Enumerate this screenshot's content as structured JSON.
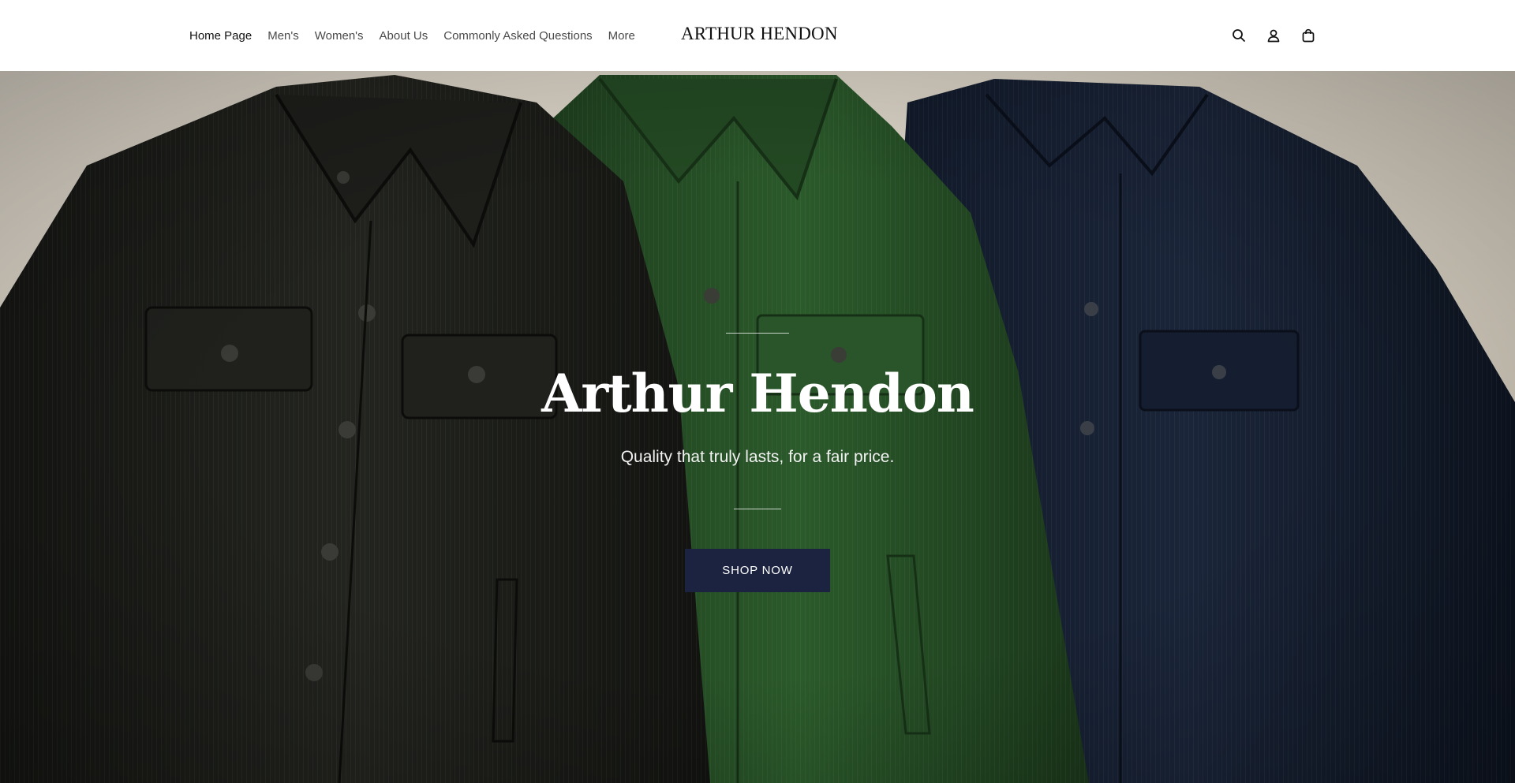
{
  "header": {
    "nav": [
      {
        "label": "Home Page"
      },
      {
        "label": "Men's"
      },
      {
        "label": "Women's"
      },
      {
        "label": "About Us"
      },
      {
        "label": "Commonly Asked Questions"
      },
      {
        "label": "More"
      }
    ],
    "logo": "ARTHUR HENDON",
    "icons": [
      "search-icon",
      "account-icon",
      "cart-icon"
    ]
  },
  "hero": {
    "title": "Arthur Hendon",
    "subtitle": "Quality that truly lasts, for a fair price.",
    "cta_label": "SHOP NOW",
    "colors": {
      "background": "#d7d1c6",
      "jacket_left": "#1b1c19",
      "jacket_center": "#244a24",
      "jacket_right": "#141d2e",
      "button": "#1c2340"
    }
  }
}
